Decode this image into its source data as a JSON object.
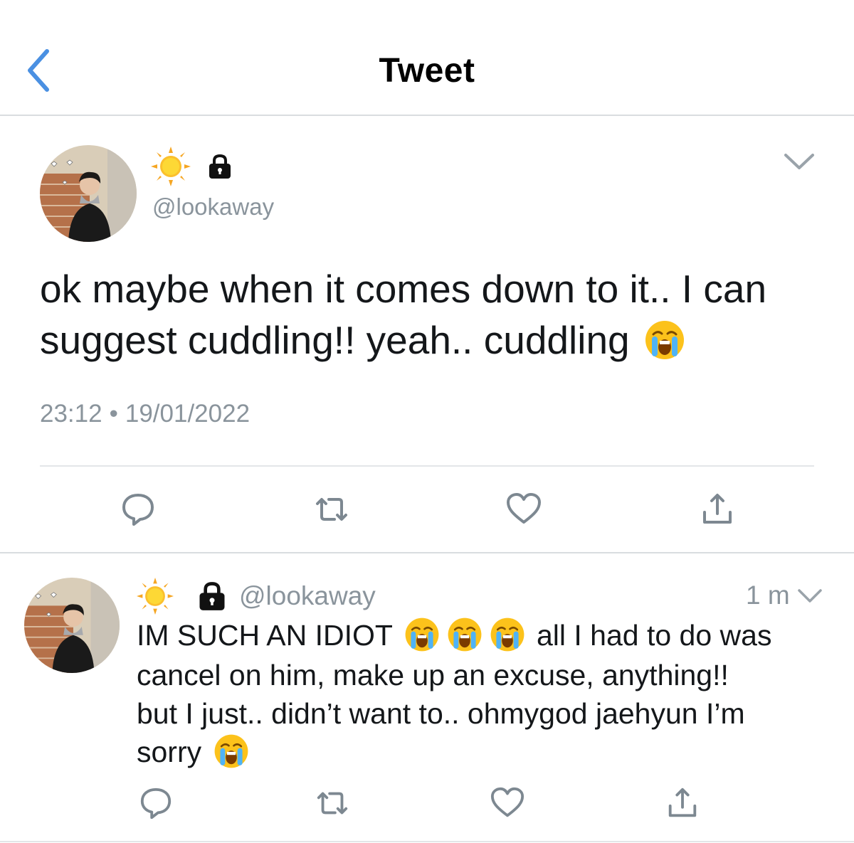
{
  "header": {
    "title": "Tweet",
    "back_icon": "chevron-left-icon"
  },
  "tweet": {
    "name_icons": [
      "sun-icon",
      "lock-icon"
    ],
    "handle": "@lookaway",
    "text_lines": [
      "ok maybe when it comes down to it.. I can",
      "suggest cuddling!! yeah.. cuddling"
    ],
    "trailing_emoji": "loudly-crying-face-icon",
    "time": "23:12",
    "separator": "•",
    "date": "19/01/2022",
    "actions": [
      "reply-icon",
      "retweet-icon",
      "like-icon",
      "share-icon"
    ]
  },
  "reply": {
    "handle": "@lookaway",
    "time_ago": "1 m",
    "text_part1": "IM SUCH AN IDIOT",
    "text_part2": "all I had to do was",
    "text_line2": "cancel on him, make up an excuse, anything!!",
    "text_line3": "but I just.. didn’t want to.. ohmygod jaehyun I’m",
    "text_line4": "sorry"
  },
  "colors": {
    "accent": "#4a90e2",
    "text_primary": "#14171a",
    "text_secondary": "#8a949c",
    "icon_gray": "#7d8891",
    "divider": "#d9dde0"
  }
}
